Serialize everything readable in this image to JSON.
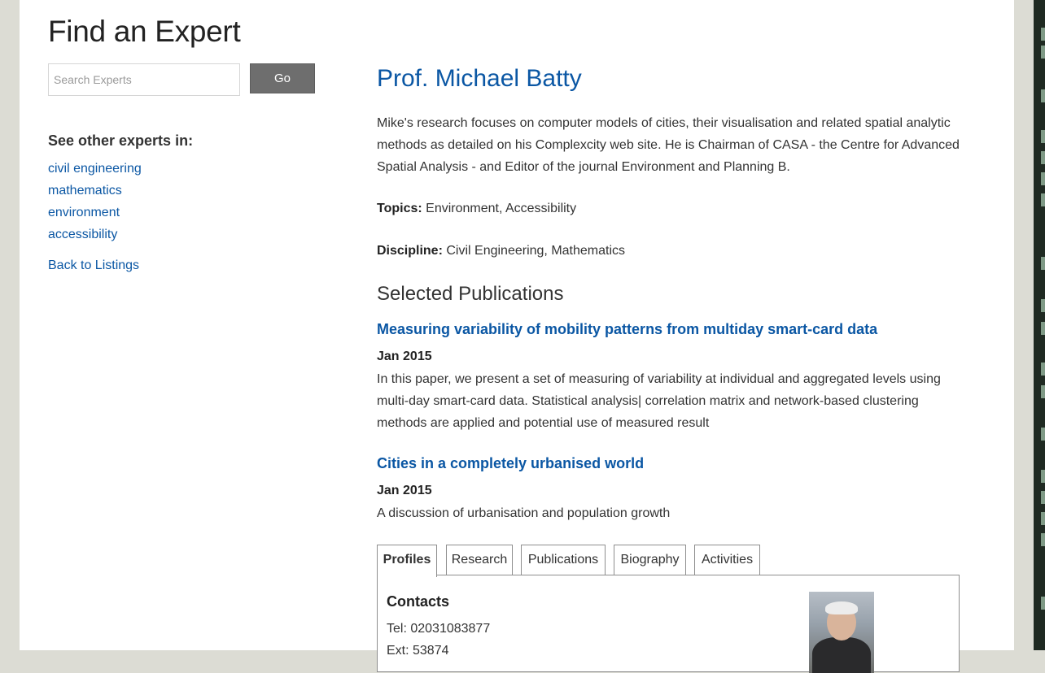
{
  "page_title": "Find an Expert",
  "search": {
    "placeholder": "Search Experts",
    "button_label": "Go"
  },
  "sidebar": {
    "heading": "See other experts in:",
    "links": [
      "civil engineering",
      "mathematics",
      "environment",
      "accessibility"
    ],
    "back_label": "Back to Listings"
  },
  "expert": {
    "name": "Prof. Michael Batty",
    "bio": "Mike's research focuses on computer models of cities, their visualisation and related spatial analytic methods as detailed on his Complexcity web site. He is Chairman of CASA - the Centre for Advanced Spatial Analysis - and Editor of the journal Environment and Planning B.",
    "topics_label": "Topics:",
    "topics": "Environment, Accessibility",
    "discipline_label": "Discipline:",
    "discipline": "Civil Engineering, Mathematics"
  },
  "publications": {
    "heading": "Selected Publications",
    "items": [
      {
        "title": "Measuring variability of mobility patterns from multiday smart-card data",
        "date": "Jan 2015",
        "abstract": "In this paper, we present a set of measuring of variability at individual and aggregated levels using multi-day smart-card data. Statistical analysis| correlation matrix and network-based clustering methods are applied and potential use of measured result"
      },
      {
        "title": "Cities in a completely urbanised world",
        "date": "Jan 2015",
        "abstract": "A discussion of urbanisation and population growth"
      }
    ]
  },
  "tabs": [
    "Profiles",
    "Research",
    "Publications",
    "Biography",
    "Activities"
  ],
  "active_tab": "Profiles",
  "contacts": {
    "heading": "Contacts",
    "tel": "Tel: 02031083877",
    "ext": "Ext: 53874"
  },
  "colors": {
    "link": "#0b57a4",
    "button": "#6e6e6e",
    "background": "#dcdcd4"
  }
}
